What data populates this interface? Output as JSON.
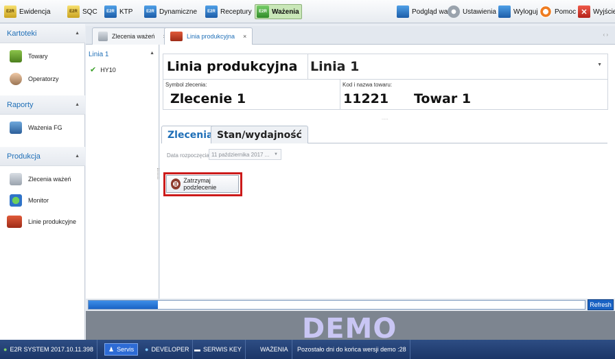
{
  "toolbar": {
    "left": [
      {
        "label": "Ewidencja",
        "icon": "e2r-ewidencja-icon",
        "badge": "E2R"
      },
      {
        "label": "SQC",
        "icon": "e2r-sqc-icon",
        "badge": "E2R"
      },
      {
        "label": "KTP",
        "icon": "e2r-ktp-icon",
        "badge": "E2R"
      },
      {
        "label": "Dynamiczne",
        "icon": "e2r-dynamiczne-icon",
        "badge": "E2R"
      },
      {
        "label": "Receptury",
        "icon": "e2r-receptury-icon",
        "badge": "E2R"
      },
      {
        "label": "Ważenia",
        "icon": "e2r-wazenia-icon",
        "badge": "E2R"
      }
    ],
    "right": [
      {
        "label": "Podgląd wag",
        "icon": "scale-preview-icon"
      },
      {
        "label": "Ustawienia",
        "icon": "settings-icon"
      },
      {
        "label": "Wyloguj",
        "icon": "logout-icon"
      },
      {
        "label": "Pomoc",
        "icon": "help-lifebuoy-icon"
      },
      {
        "label": "Wyjście",
        "icon": "exit-icon",
        "glyph": "✕"
      }
    ]
  },
  "sidebar": {
    "sections": [
      {
        "label": "Kartoteki",
        "items": [
          {
            "label": "Towary"
          },
          {
            "label": "Operatorzy"
          }
        ]
      },
      {
        "label": "Raporty",
        "items": [
          {
            "label": "Ważenia FG"
          }
        ]
      },
      {
        "label": "Produkcja",
        "items": [
          {
            "label": "Zlecenia ważeń"
          },
          {
            "label": "Monitor"
          },
          {
            "label": "Linie produkcyjne"
          }
        ]
      }
    ]
  },
  "tree": {
    "root": "Linia 1",
    "child": "HY10"
  },
  "doc_tabs": [
    {
      "label": "Zlecenia ważeń",
      "close": "×"
    },
    {
      "label": "Linia produkcyjna",
      "close": "×"
    }
  ],
  "doc_tabs_nav": "‹ ›",
  "main": {
    "title_prefix": "Linia produkcyjna",
    "line_value": "Linia 1",
    "symbol_label": "Symbol zlecenia:",
    "symbol_value": "Zlecenie 1",
    "kod_label": "Kod i nazwa towaru:",
    "kod_value": "11221",
    "towar_value": "Towar 1",
    "splitter_dots": ".....",
    "tabs": [
      "Zlecenia",
      "Stan/wydajność"
    ],
    "date_label": "Data rozpoczęcia",
    "date_value": "11 października 2017 ...",
    "stop_button": "Zatrzymaj podzlecenie"
  },
  "progress": {
    "fraction": 0.14
  },
  "refresh_label": "Refresh",
  "watermark": "DEMO",
  "status": {
    "system": "E2R SYSTEM 2017.10.11.398",
    "servis": "Servis",
    "developer": "DEVELOPER",
    "serwis_key": "SERWIS KEY",
    "module": "WAŻENIA",
    "demo_days": "Pozostało dni do końca wersji demo :28"
  },
  "colors": {
    "accent": "#1f6fb7",
    "highlight_frame": "#cc1a1a",
    "progress": "#1a63c4",
    "status_bar": "#1c3668"
  }
}
